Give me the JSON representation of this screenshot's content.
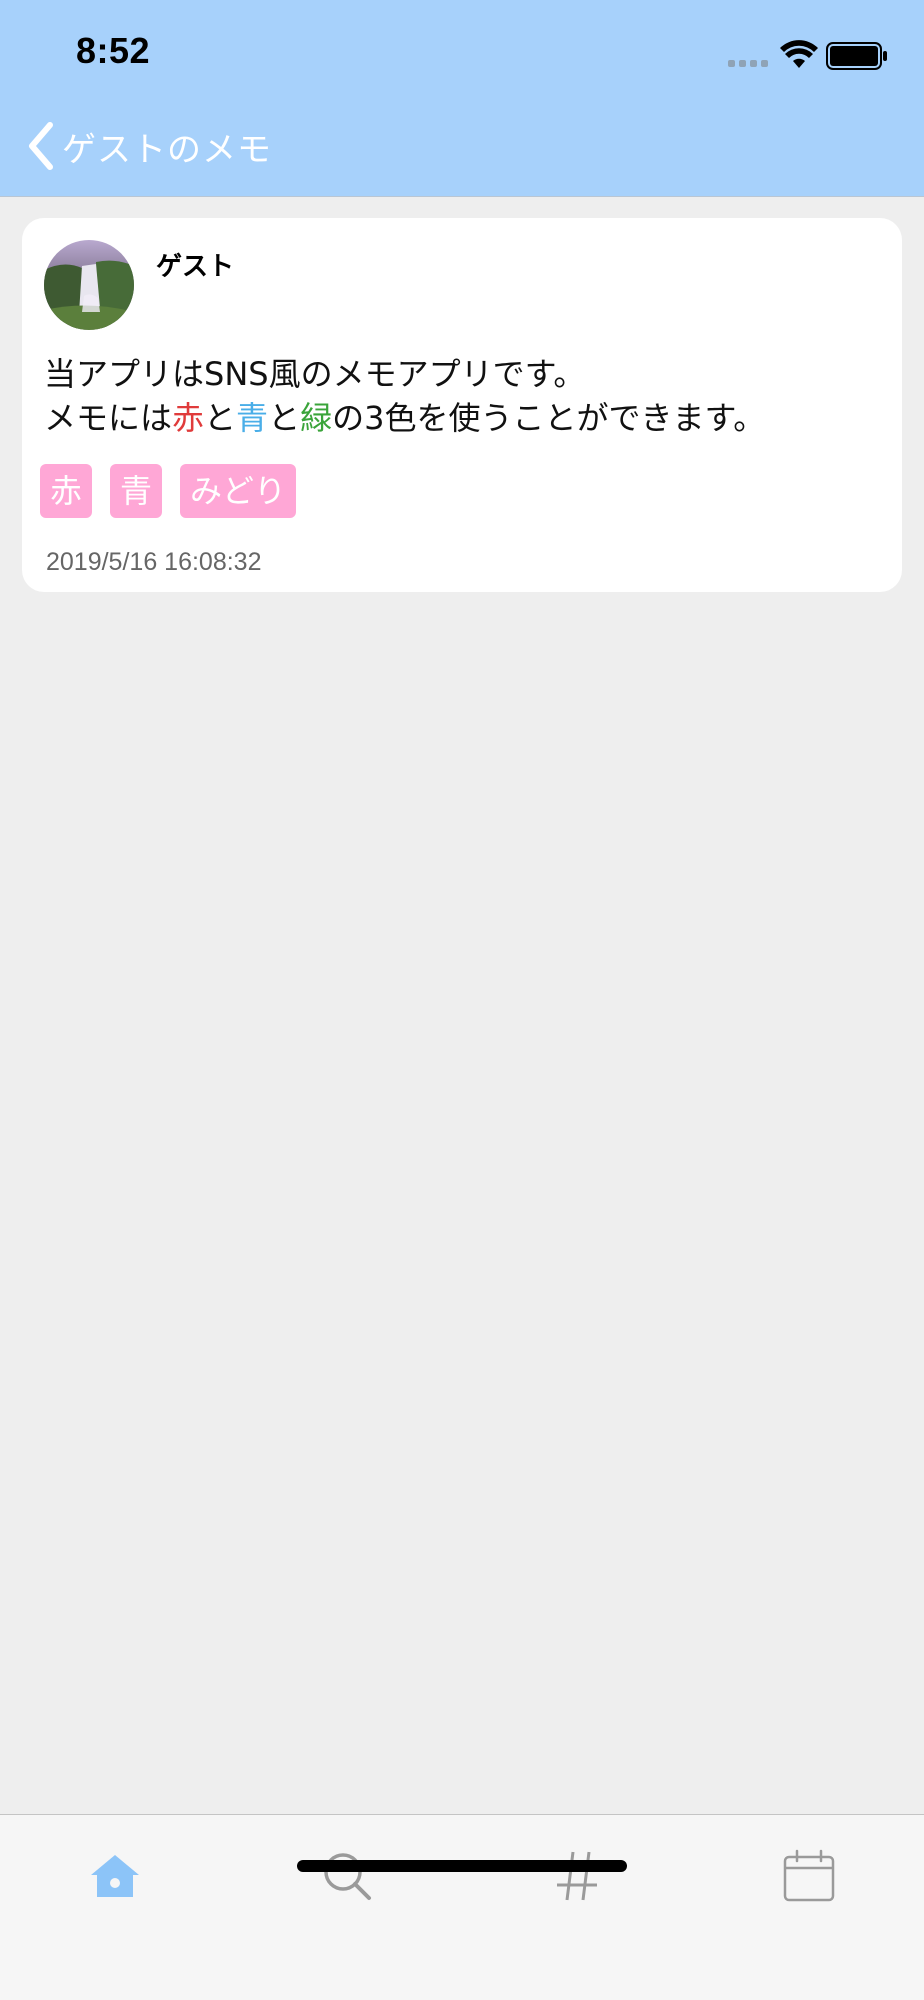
{
  "status_bar": {
    "time": "8:52"
  },
  "nav": {
    "back_title": "ゲストのメモ"
  },
  "memo": {
    "author": "ゲスト",
    "text_line1": " 当アプリはSNS風のメモアプリです。",
    "text_line2": {
      "part1": "メモには",
      "red_word": "赤",
      "part2": "と",
      "blue_word": "青",
      "part3": "と",
      "green_word": "緑",
      "part4": "の3色を使うことができます。"
    },
    "tags": [
      "赤",
      "青",
      "みどり"
    ],
    "timestamp": "2019/5/16 16:08:32"
  },
  "tab_bar": {
    "tabs": [
      "home-icon",
      "search-icon",
      "hashtag-icon",
      "calendar-icon"
    ],
    "active": "home-icon"
  },
  "colors": {
    "nav_background": "#a7d1fb",
    "tag_background": "#ffa7d6",
    "active_tab": "#8cc4f8",
    "inactive_tab": "#9a9a9a",
    "red_text": "#e03b3b",
    "blue_text": "#4aaee8",
    "green_text": "#3aa43a"
  }
}
